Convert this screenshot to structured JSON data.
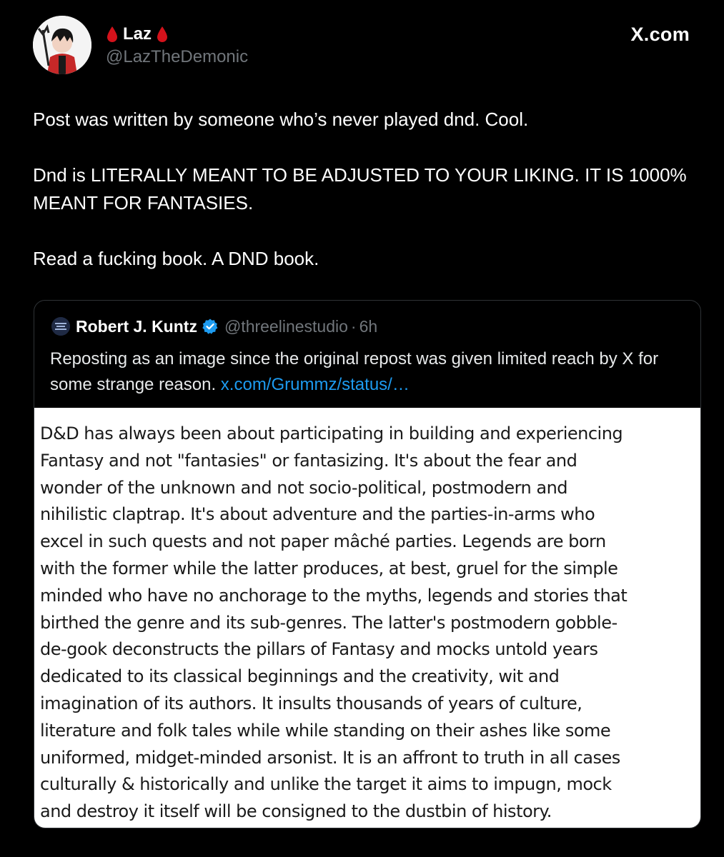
{
  "tweet": {
    "display_name": "Laz",
    "handle": "@LazTheDemonic",
    "brand": "X.com",
    "icons": {
      "name_decoration": "blood-drop-icon",
      "avatar": "avatar"
    },
    "colors": {
      "background": "#000000",
      "text": "#ffffff",
      "muted": "#71767b",
      "link": "#1d9bf0",
      "blood": "#d4121b"
    },
    "paragraphs": [
      "Post was written by someone who’s never played dnd. Cool.",
      "Dnd is LITERALLY MEANT TO BE ADJUSTED TO YOUR LIKING. IT IS 1000% MEANT FOR FANTASIES.",
      "Read a fucking book. A DND book."
    ]
  },
  "quote": {
    "name": "Robert J. Kuntz",
    "handle": "@threelinestudio",
    "separator": "·",
    "time": "6h",
    "verified_icon": "verified-badge-icon",
    "text": "Reposting as an image since the original repost was given limited reach by X for some strange reason.",
    "link": "x.com/Grummz/status/…",
    "image_lines": [
      "D&D has always been about participating in building and experiencing",
      "Fantasy and not \"fantasies\" or fantasizing.  It's about the fear and",
      "wonder of the unknown and not socio-political, postmodern and",
      "nihilistic claptrap.  It's about adventure and the parties-in-arms who",
      "excel in such quests and not paper mâché parties.  Legends are born",
      "with the former while the latter produces, at best, gruel for the simple",
      "minded who have no anchorage to the myths, legends and stories that",
      "birthed the genre and its sub-genres.  The latter's postmodern gobble-",
      "de-gook deconstructs the pillars of Fantasy and mocks untold years",
      "dedicated to its classical beginnings and the creativity, wit and",
      "imagination of its authors.  It insults thousands of years of culture,",
      "literature and folk tales while while standing on their ashes like some",
      "uniformed, midget-minded arsonist.  It is an affront to truth in all cases",
      "culturally &  historically  and unlike the target it aims to impugn, mock",
      "and destroy it itself will be consigned to the dustbin of history."
    ]
  }
}
